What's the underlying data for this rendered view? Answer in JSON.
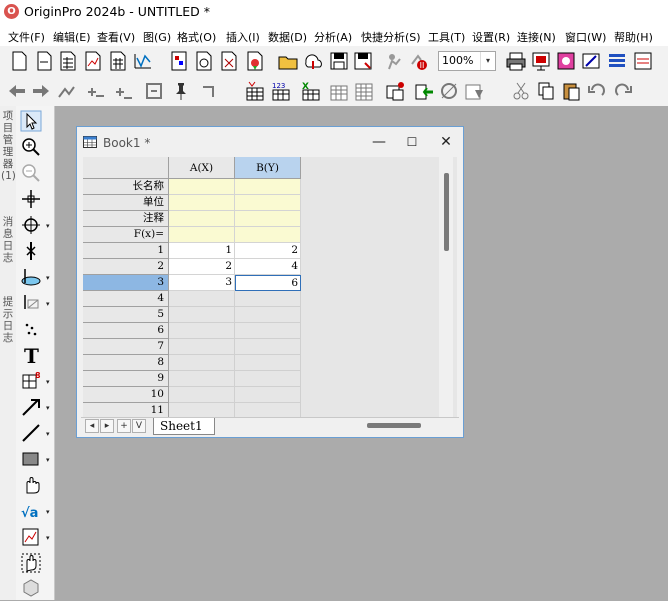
{
  "app": {
    "title": "OriginPro 2024b - UNTITLED *",
    "logo_letter": "O"
  },
  "menu": [
    "文件(F)",
    "编辑(E)",
    "查看(V)",
    "图(G)",
    "格式(O)",
    "插入(I)",
    "数据(D)",
    "分析(A)",
    "快捷分析(S)",
    "工具(T)",
    "设置(R)",
    "连接(N)",
    "窗口(W)",
    "帮助(H)"
  ],
  "toolbar": {
    "zoom_value": "100%",
    "zoom_arrow": "▾"
  },
  "left_panel": {
    "tabs": [
      "项目管理器 (1)",
      "消息日志",
      "提示日志"
    ]
  },
  "book": {
    "title": "Book1 *",
    "min_label": "—",
    "max_label": "☐",
    "close_label": "✕",
    "columns": [
      {
        "header": "A(X)"
      },
      {
        "header": "B(Y)"
      }
    ],
    "meta_rows": [
      "长名称",
      "单位",
      "注释",
      "F(x)="
    ],
    "rows": [
      {
        "num": "1",
        "a": "1",
        "b": "2"
      },
      {
        "num": "2",
        "a": "2",
        "b": "4"
      },
      {
        "num": "3",
        "a": "3",
        "b": "6"
      },
      {
        "num": "4",
        "a": "",
        "b": ""
      },
      {
        "num": "5",
        "a": "",
        "b": ""
      },
      {
        "num": "6",
        "a": "",
        "b": ""
      },
      {
        "num": "7",
        "a": "",
        "b": ""
      },
      {
        "num": "8",
        "a": "",
        "b": ""
      },
      {
        "num": "9",
        "a": "",
        "b": ""
      },
      {
        "num": "10",
        "a": "",
        "b": ""
      },
      {
        "num": "11",
        "a": "",
        "b": ""
      }
    ],
    "sheet_tab": "Sheet1",
    "nav_buttons": [
      "◂",
      "▸",
      "+",
      "V"
    ],
    "colors": {
      "selected_col": "#b9d3ee",
      "selected_row": "#8db7e3",
      "meta": "#fafad2"
    }
  }
}
